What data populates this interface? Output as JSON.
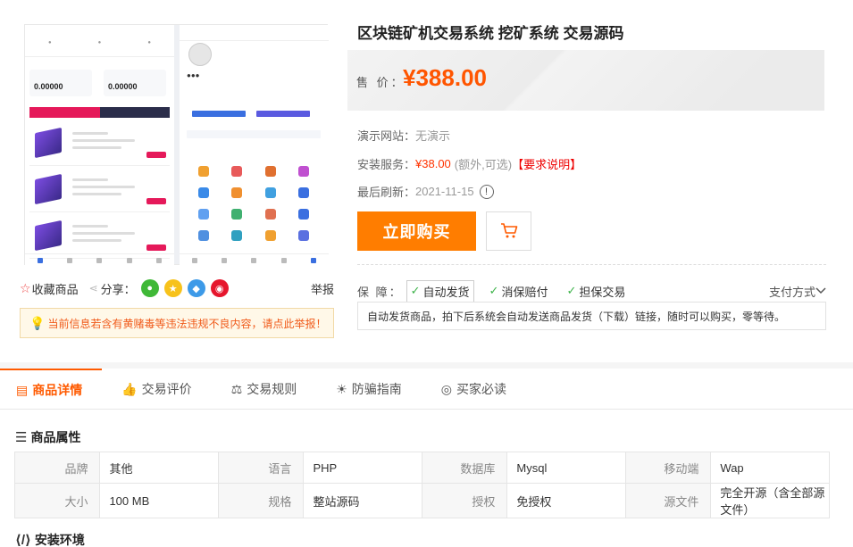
{
  "product": {
    "title": "区块链矿机交易系统 挖矿系统 交易源码",
    "price_label": "售 价：",
    "price": "¥388.00"
  },
  "info": {
    "demo_label": "演示网站：",
    "demo_value": "无演示",
    "install_label": "安装服务：",
    "install_price": "¥38.00",
    "install_note": "(额外,可选)",
    "install_req": "【要求说明】",
    "refresh_label": "最后刷新：",
    "refresh_date": "2021-11-15",
    "refresh_icon": "!"
  },
  "actions": {
    "buy_label": "立即购买"
  },
  "guarantee": {
    "label": "保 障：",
    "items": [
      "自动发货",
      "消保赔付",
      "担保交易"
    ],
    "pay_label": "支付方式",
    "description": "自动发货商品，拍下后系统会自动发送商品发货（下载）链接，随时可以购买，零等待。"
  },
  "share": {
    "favorite": "收藏商品",
    "share_label": "分享：",
    "report": "举报"
  },
  "notice": "当前信息若含有黄赌毒等违法违规不良内容，请点此举报！",
  "tabs": [
    "商品详情",
    "交易评价",
    "交易规则",
    "防骗指南",
    "买家必读"
  ],
  "sections": {
    "attr_title": "商品属性",
    "env_title": "安装环境"
  },
  "attributes": [
    [
      [
        "品牌",
        "其他"
      ],
      [
        "语言",
        "PHP"
      ],
      [
        "数据库",
        "Mysql"
      ],
      [
        "移动端",
        "Wap"
      ]
    ],
    [
      [
        "大小",
        "100 MB"
      ],
      [
        "规格",
        "整站源码"
      ],
      [
        "授权",
        "免授权"
      ],
      [
        "源文件",
        "完全开源（含全部源文件）"
      ]
    ]
  ],
  "colors": {
    "accent": "#ff7d00",
    "price": "#ff5500",
    "wechat": "#3fb837",
    "qzone": "#f7c21b",
    "qq": "#3d9ae8",
    "weibo": "#e6162d"
  }
}
